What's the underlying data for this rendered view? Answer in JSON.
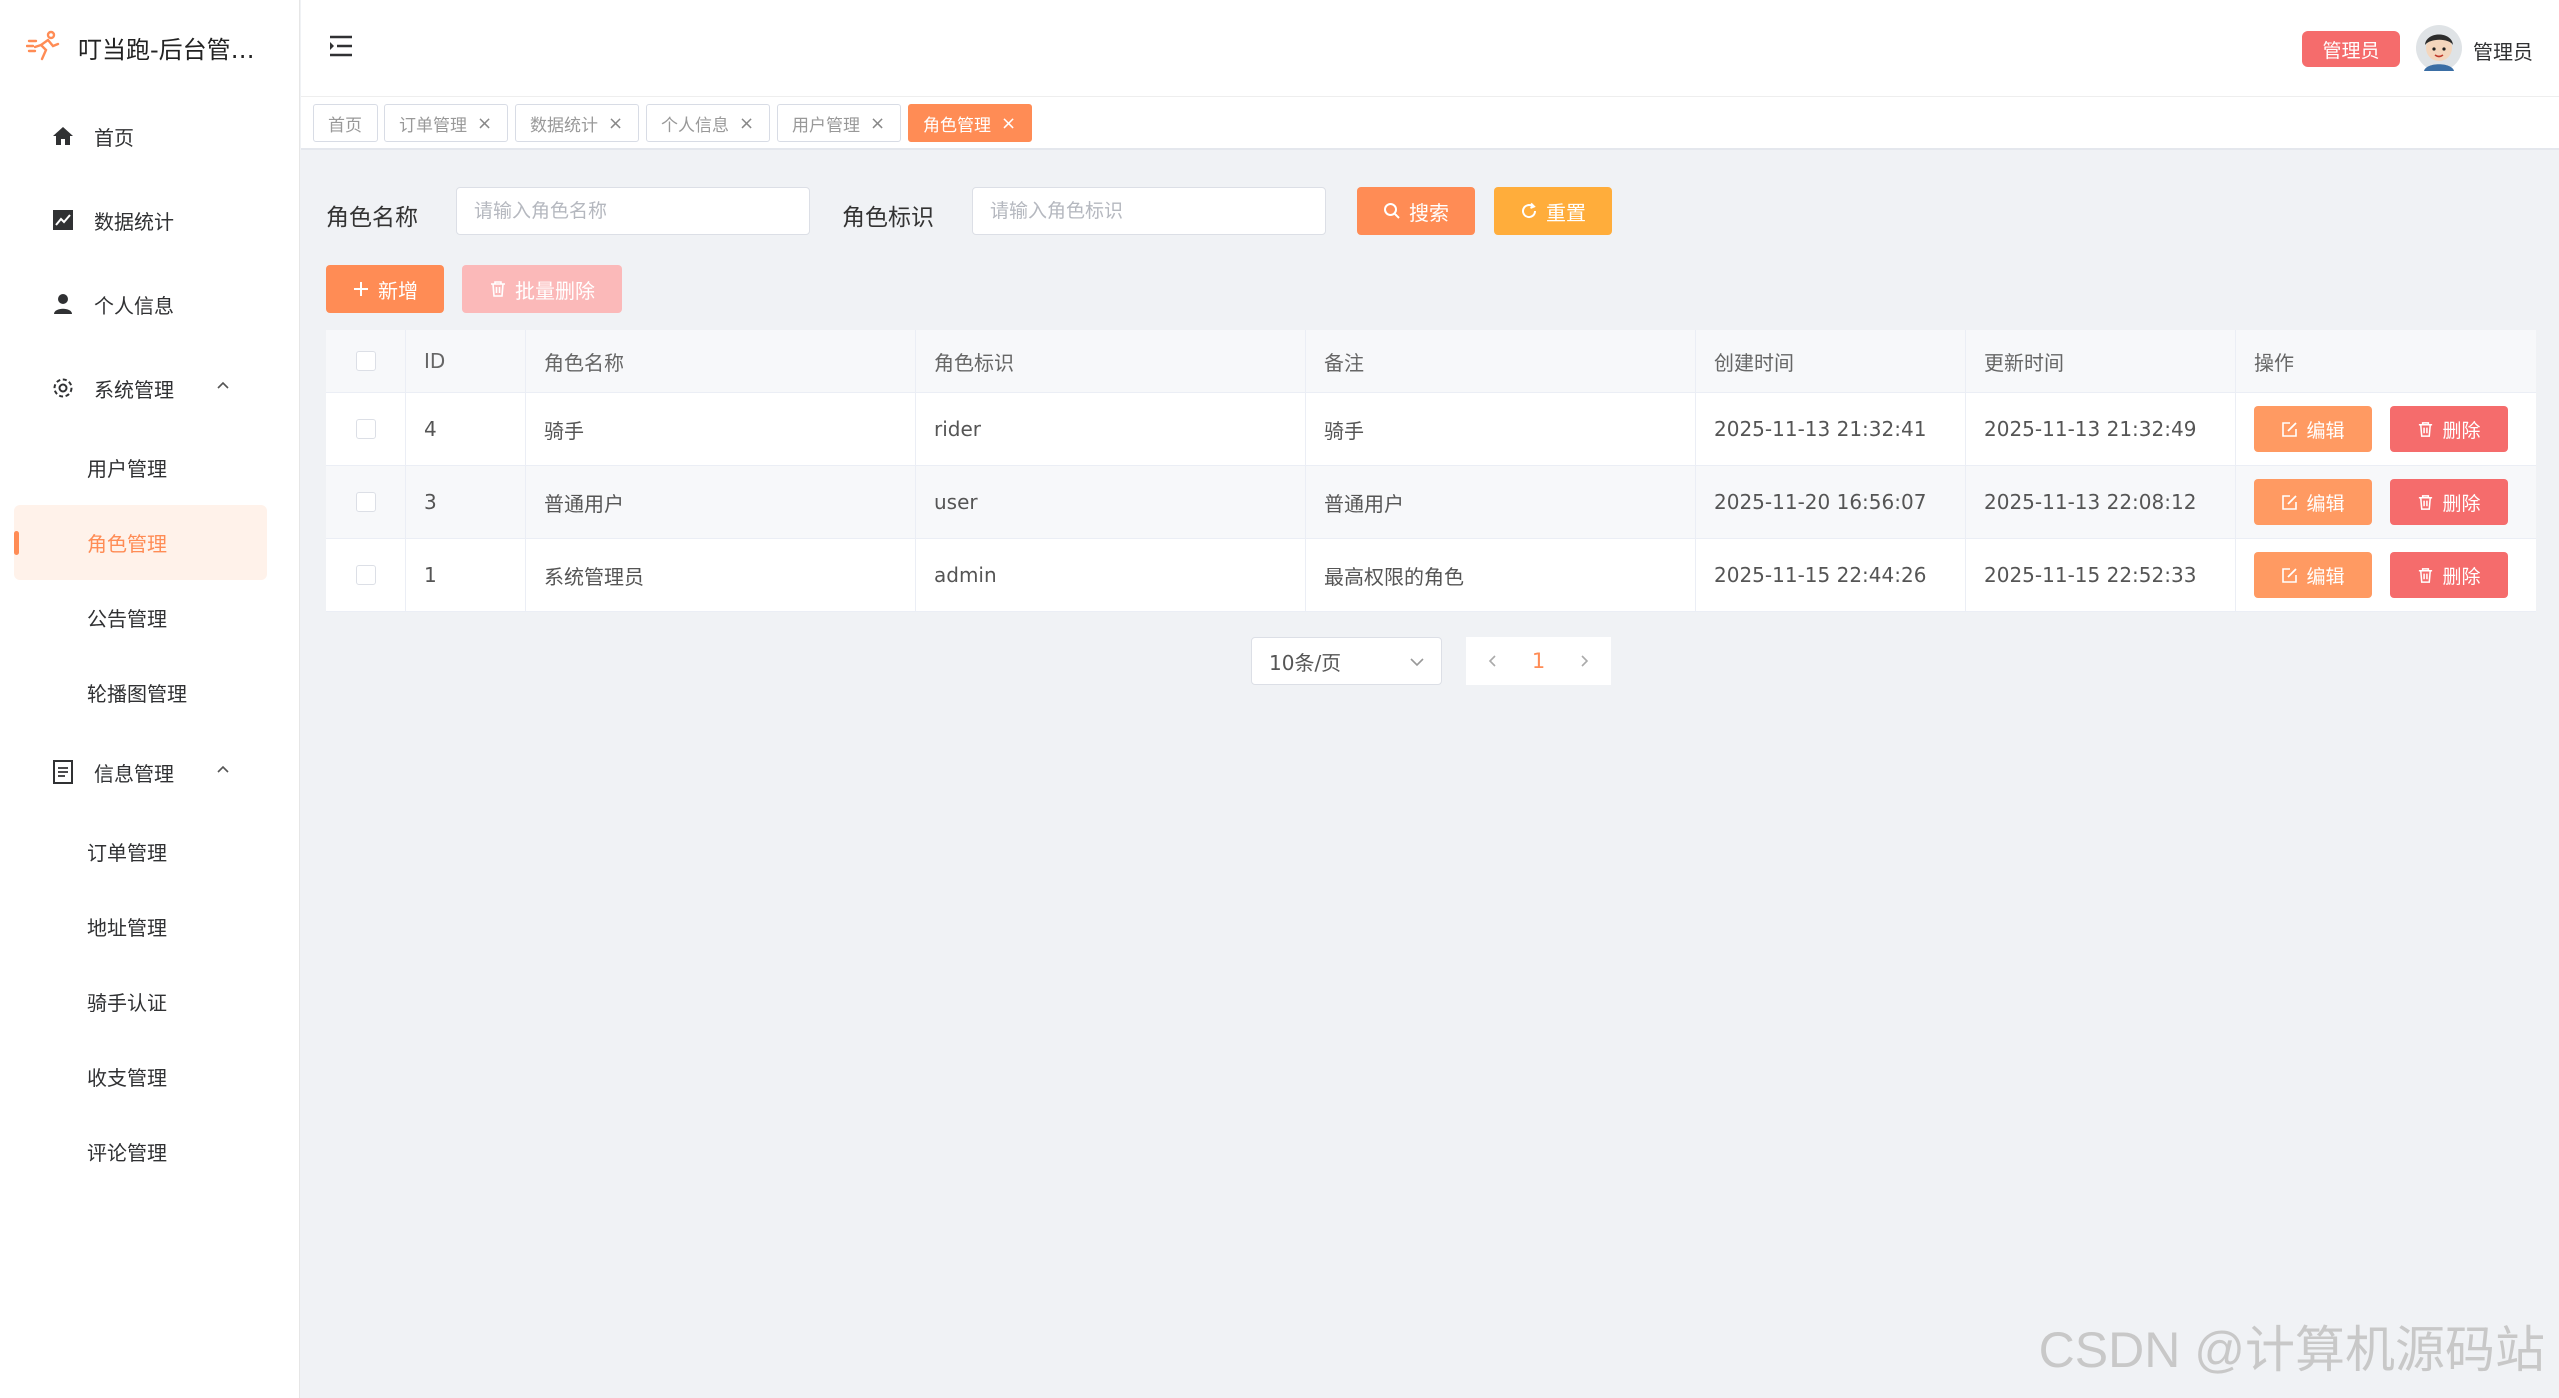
{
  "app": {
    "title": "叮当跑-后台管理系统",
    "title_shown": "叮当跑-后台管…"
  },
  "sidebar": {
    "items": [
      {
        "label": "首页",
        "icon": "home-icon"
      },
      {
        "label": "数据统计",
        "icon": "chart-icon"
      },
      {
        "label": "个人信息",
        "icon": "user-icon"
      },
      {
        "label": "系统管理",
        "icon": "gear-icon",
        "expanded": true,
        "children": [
          "用户管理",
          "角色管理",
          "公告管理",
          "轮播图管理"
        ]
      },
      {
        "label": "信息管理",
        "icon": "document-icon",
        "expanded": true,
        "children": [
          "订单管理",
          "地址管理",
          "骑手认证",
          "收支管理",
          "评论管理"
        ]
      }
    ],
    "active": "角色管理"
  },
  "header": {
    "role_badge": "管理员",
    "user_name": "管理员"
  },
  "tabs": [
    {
      "label": "首页",
      "closable": false
    },
    {
      "label": "订单管理",
      "closable": true
    },
    {
      "label": "数据统计",
      "closable": true
    },
    {
      "label": "个人信息",
      "closable": true
    },
    {
      "label": "用户管理",
      "closable": true
    },
    {
      "label": "角色管理",
      "closable": true,
      "active": true
    }
  ],
  "tab_close": "×",
  "search": {
    "name_label": "角色名称",
    "name_placeholder": "请输入角色名称",
    "code_label": "角色标识",
    "code_placeholder": "请输入角色标识",
    "search_btn": "搜索",
    "reset_btn": "重置"
  },
  "toolbar": {
    "add_btn": "新增",
    "batch_delete_btn": "批量删除"
  },
  "table": {
    "columns": [
      "ID",
      "角色名称",
      "角色标识",
      "备注",
      "创建时间",
      "更新时间",
      "操作"
    ],
    "rows": [
      {
        "id": "4",
        "name": "骑手",
        "code": "rider",
        "remark": "骑手",
        "created": "2025-11-13 21:32:41",
        "updated": "2025-11-13 21:32:49"
      },
      {
        "id": "3",
        "name": "普通用户",
        "code": "user",
        "remark": "普通用户",
        "created": "2025-11-20 16:56:07",
        "updated": "2025-11-13 22:08:12"
      },
      {
        "id": "1",
        "name": "系统管理员",
        "code": "admin",
        "remark": "最高权限的角色",
        "created": "2025-11-15 22:44:26",
        "updated": "2025-11-15 22:52:33"
      }
    ],
    "edit_btn": "编辑",
    "delete_btn": "删除"
  },
  "pagination": {
    "page_size": "10条/页",
    "current_page": "1"
  },
  "watermark": "CSDN @计算机源码站",
  "colors": {
    "accent": "#ff8c55",
    "danger": "#f56c6c",
    "warning": "#ffad3b"
  }
}
